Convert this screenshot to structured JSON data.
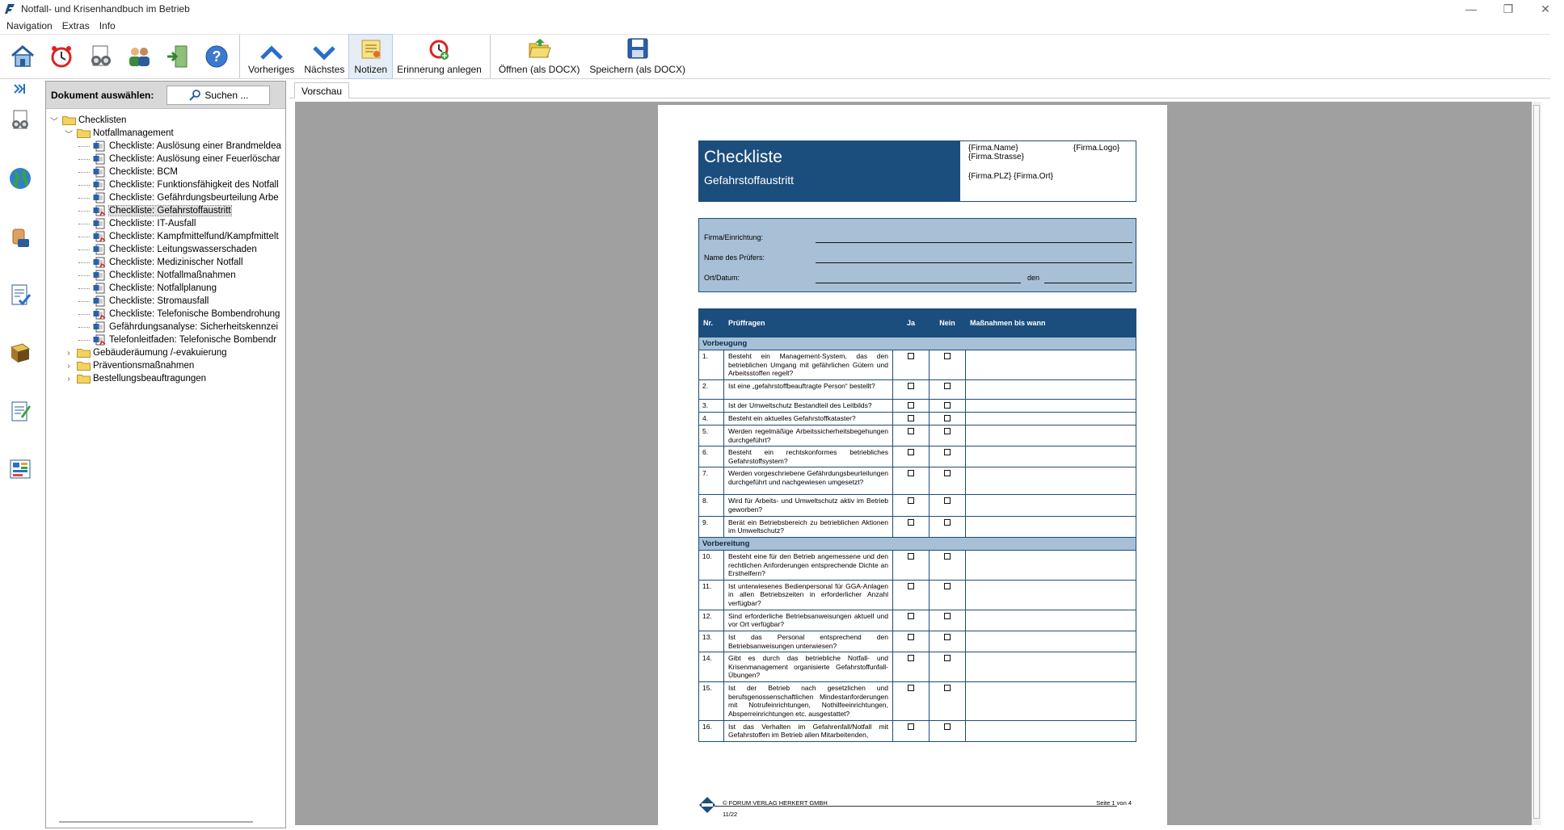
{
  "window": {
    "title": "Notfall- und Krisenhandbuch im Betrieb"
  },
  "menu": [
    "Navigation",
    "Extras",
    "Info"
  ],
  "toolbar": {
    "buttons": [
      {
        "label": "Vorheriges"
      },
      {
        "label": "Nächstes"
      },
      {
        "label": "Notizen"
      },
      {
        "label": "Erinnerung anlegen"
      },
      {
        "label": "Öffnen (als DOCX)"
      },
      {
        "label": "Speichern (als DOCX)"
      }
    ]
  },
  "panel": {
    "header_label": "Dokument auswählen:",
    "search_label": "Suchen ...",
    "tree": [
      {
        "label": "Checklisten"
      },
      {
        "label": "Notfallmanagement"
      },
      {
        "label": "Checkliste: Auslösung einer Brandmeldea"
      },
      {
        "label": "Checkliste: Auslösung einer Feuerlöschar"
      },
      {
        "label": "Checkliste: BCM"
      },
      {
        "label": "Checkliste: Funktionsfähigkeit des Notfall"
      },
      {
        "label": "Checkliste: Gefährdungsbeurteilung Arbe"
      },
      {
        "label": "Checkliste: Gefahrstoffaustritt"
      },
      {
        "label": "Checkliste: IT-Ausfall"
      },
      {
        "label": "Checkliste: Kampfmittelfund/Kampfmittelt"
      },
      {
        "label": "Checkliste: Leitungswasserschaden"
      },
      {
        "label": "Checkliste: Medizinischer Notfall"
      },
      {
        "label": "Checkliste: Notfallmaßnahmen"
      },
      {
        "label": "Checkliste: Notfallplanung"
      },
      {
        "label": "Checkliste: Stromausfall"
      },
      {
        "label": "Checkliste: Telefonische Bombendrohung"
      },
      {
        "label": "Gefährdungsanalyse: Sicherheitskennzei"
      },
      {
        "label": "Telefonleitfaden: Telefonische Bombendr"
      },
      {
        "label": "Gebäuderäumung /-evakuierung"
      },
      {
        "label": "Präventionsmaßnahmen"
      },
      {
        "label": "Bestellungsbeauftragungen"
      }
    ]
  },
  "preview": {
    "tab_label": "Vorschau",
    "doc": {
      "title": "Checkliste",
      "subtitle": "Gefahrstoffaustritt",
      "firma_name": "{Firma.Name}",
      "firma_logo": "{Firma.Logo}",
      "firma_strasse": "{Firma.Strasse}",
      "firma_plz_ort": "{Firma.PLZ} {Firma.Ort}",
      "form": {
        "firma_label": "Firma/Einrichtung:",
        "pruefer_label": "Name des Prüfers:",
        "ortdatum_label": "Ort/Datum:",
        "den_label": "den"
      },
      "table": {
        "headers": [
          "Nr.",
          "Prüffragen",
          "Ja",
          "Nein",
          "Maßnahmen bis wann"
        ],
        "sections": [
          {
            "title": "Vorbeugung",
            "rows": [
              {
                "nr": "1.",
                "q": "Besteht ein Management-System, das den betrieblichen Umgang mit gefährlichen Gütern und Arbeitsstoffen regelt?"
              },
              {
                "nr": "2.",
                "q": "Ist eine „gefahrstoffbeauftragte Person“ bestellt?"
              },
              {
                "nr": "3.",
                "q": "Ist der Umweltschutz Bestandteil des Leitbilds?"
              },
              {
                "nr": "4.",
                "q": "Besteht ein aktuelles Gefahrstoffkataster?"
              },
              {
                "nr": "5.",
                "q": "Werden regelmäßige Arbeitssicherheitsbegehungen durchgeführt?"
              },
              {
                "nr": "6.",
                "q": "Besteht ein rechtskonformes betriebliches Gefahrstoffsystem?"
              },
              {
                "nr": "7.",
                "q": "Werden vorgeschriebene Gefährdungsbeurteilungen durchgeführt und nachgewiesen umgesetzt?"
              },
              {
                "nr": "8.",
                "q": "Wird für Arbeits- und Umweltschutz aktiv im Betrieb geworben?"
              },
              {
                "nr": "9.",
                "q": "Berät ein Betriebsbereich zu betrieblichen Aktionen im Umweltschutz?"
              }
            ]
          },
          {
            "title": "Vorbereitung",
            "rows": [
              {
                "nr": "10.",
                "q": "Besteht eine für den Betrieb angemessene und den rechtlichen Anforderungen entsprechende Dichte an Ersthelfern?"
              },
              {
                "nr": "11.",
                "q": "Ist unterwiesenes Bedienpersonal für GGA-Anlagen in allen Betriebszeiten in erforderlicher Anzahl verfügbar?"
              },
              {
                "nr": "12.",
                "q": "Sind erforderliche Betriebsanweisungen aktuell und vor Ort verfügbar?"
              },
              {
                "nr": "13.",
                "q": "Ist das Personal entsprechend den Betriebsanweisungen unterwiesen?"
              },
              {
                "nr": "14.",
                "q": "Gibt es durch das betriebliche Notfall- und Krisenmanagement organisierte Gefahrstoffunfall-Übungen?"
              },
              {
                "nr": "15.",
                "q": "Ist der Betrieb nach gesetzlichen und berufsgenossenschaftlichen Mindestanforderungen mit Notrufeinrichtungen, Nothilfeeinrichtungen, Absperreinrichtungen etc. ausgestattet?"
              },
              {
                "nr": "16.",
                "q": "Ist das Verhalten im Gefahrenfall/Notfall mit Gefahrstoffen im Betrieb allen Mitarbeitenden,"
              }
            ]
          }
        ]
      },
      "footer": {
        "verlag": "© FORUM VERLAG HERKERT GMBH",
        "date": "11/22",
        "page": "Seite 1 von 4"
      }
    }
  },
  "colors": {
    "doc_blue": "#1b4d7d",
    "doc_light_blue": "#a7c0d6",
    "preview_bg": "#a0a0a0"
  }
}
